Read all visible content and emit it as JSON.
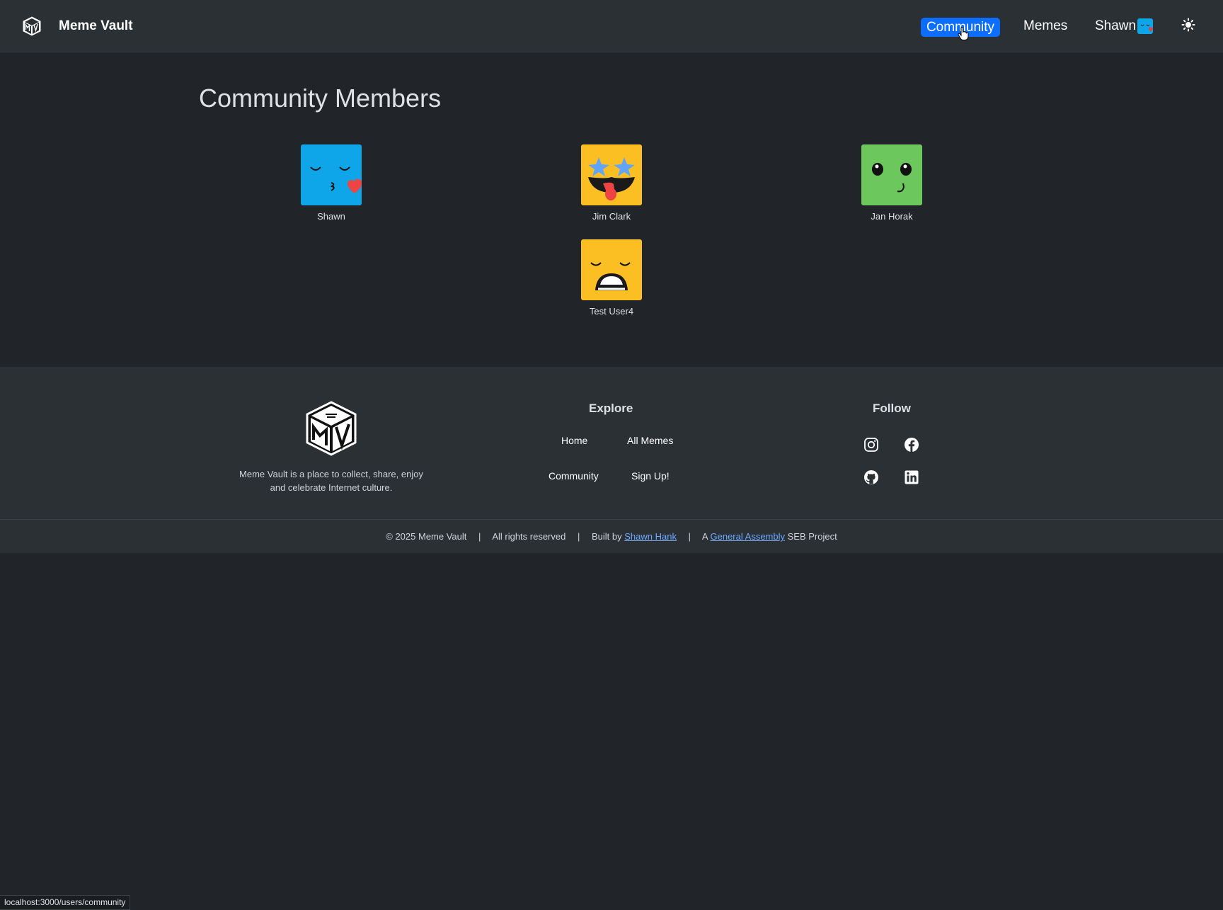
{
  "navbar": {
    "brand": "Meme Vault",
    "links": {
      "community": "Community",
      "memes": "Memes",
      "user": "Shawn"
    }
  },
  "main": {
    "title": "Community Members",
    "members": [
      {
        "name": "Shawn",
        "avatar": "kissing-face",
        "color": "#0ea5e9"
      },
      {
        "name": "Jim Clark",
        "avatar": "star-eyes-face",
        "color": "#fbbf24"
      },
      {
        "name": "Jan Horak",
        "avatar": "wink-face",
        "color": "#6cc75c"
      },
      {
        "name": "Test User4",
        "avatar": "yawning-face",
        "color": "#fbbf24"
      }
    ]
  },
  "footer": {
    "tagline": "Meme Vault is a place to collect, share, enjoy and celebrate Internet culture.",
    "explore": {
      "heading": "Explore",
      "links": [
        "Home",
        "All Memes",
        "Community",
        "Sign Up!"
      ]
    },
    "follow": {
      "heading": "Follow",
      "icons": [
        "instagram-icon",
        "facebook-icon",
        "github-icon",
        "linkedin-icon"
      ]
    },
    "bottom": {
      "copyright": "© 2025 Meme Vault",
      "separator": "|",
      "rights": "All rights reserved",
      "built_by_prefix": "Built by",
      "author": "Shawn Hank",
      "project_prefix": "A",
      "org": "General Assembly",
      "project_suffix": "SEB Project"
    }
  },
  "status_bar": {
    "url": "localhost:3000/users/community"
  },
  "colors": {
    "accent": "#0d6efd",
    "link": "#6ea8fe",
    "background": "#212529",
    "surface": "#2b3035"
  }
}
